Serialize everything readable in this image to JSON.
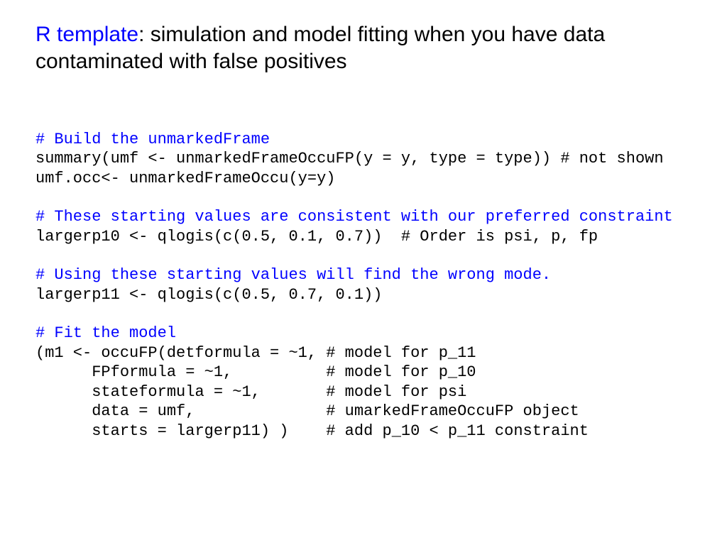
{
  "title": {
    "prefix": "R template",
    "rest": ": simulation and model fitting when you have data contaminated with false positives"
  },
  "code": {
    "c1": "# Build the unmarkedFrame",
    "l1": "summary(umf <- unmarkedFrameOccuFP(y = y, type = type)) # not shown",
    "l2": "umf.occ<- unmarkedFrameOccu(y=y)",
    "c2": "# These starting values are consistent with our preferred constraint",
    "l3": "largerp10 <- qlogis(c(0.5, 0.1, 0.7))  # Order is psi, p, fp",
    "c3": "# Using these starting values will find the wrong mode.",
    "l4": "largerp11 <- qlogis(c(0.5, 0.7, 0.1))",
    "c4": "# Fit the model",
    "l5": "(m1 <- occuFP(detformula = ~1, # model for p_11",
    "l6": "      FPformula = ~1,          # model for p_10",
    "l7": "      stateformula = ~1,       # model for psi",
    "l8": "      data = umf,              # umarkedFrameOccuFP object",
    "l9": "      starts = largerp11) )    # add p_10 < p_11 constraint"
  }
}
